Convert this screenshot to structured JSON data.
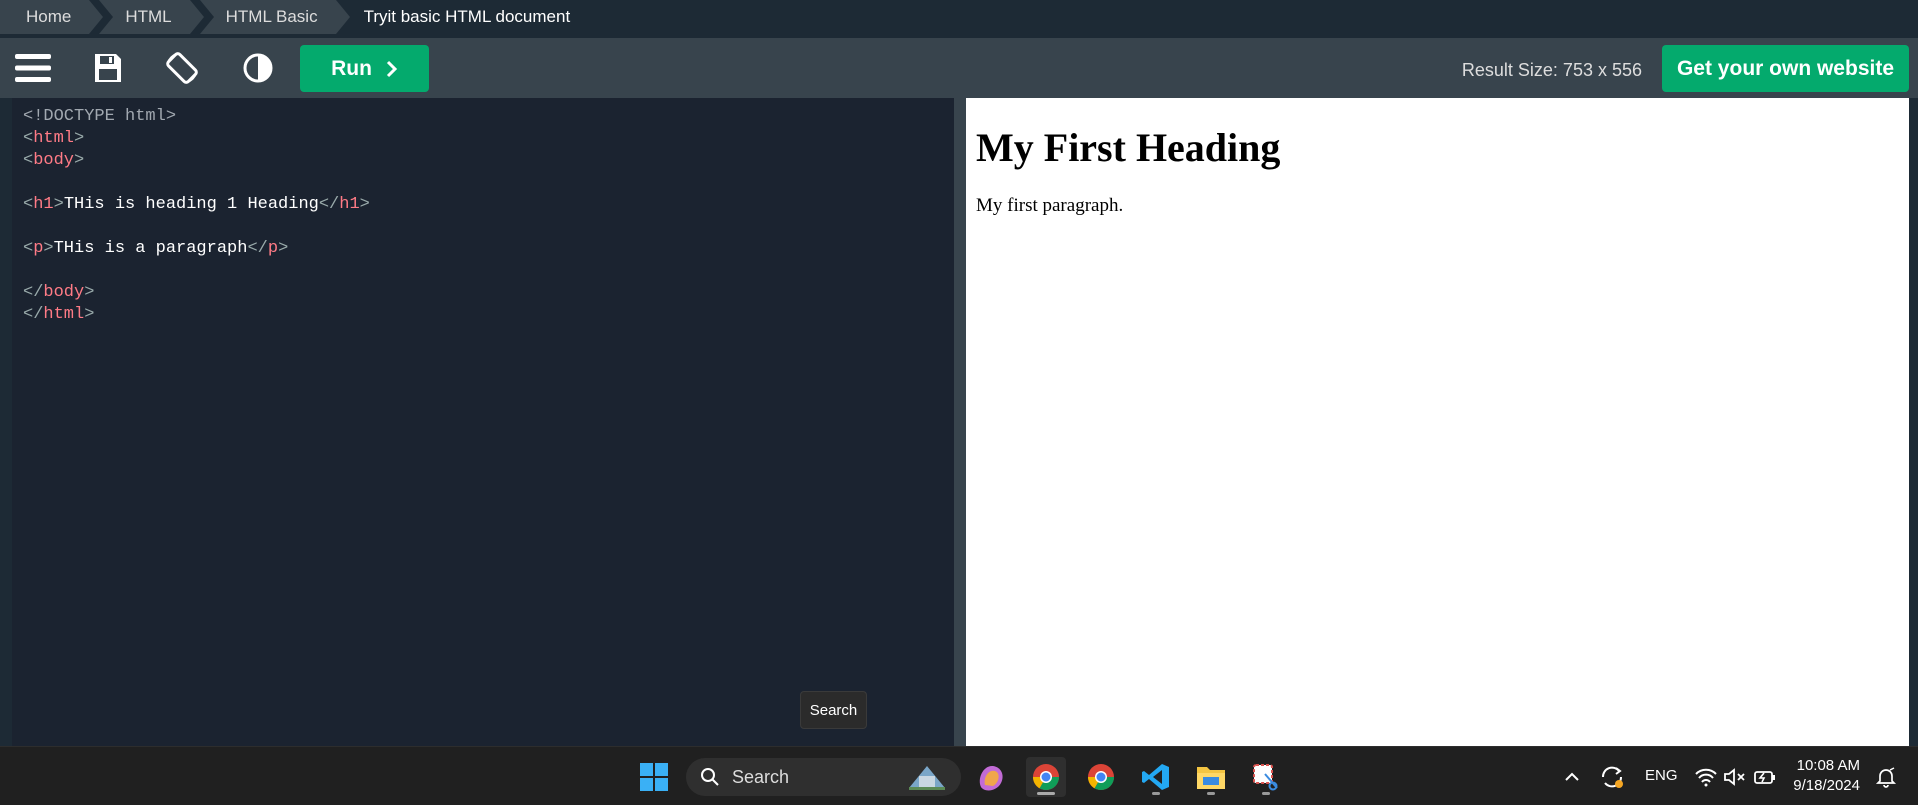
{
  "breadcrumb": {
    "items": [
      "Home",
      "HTML",
      "HTML Basic"
    ],
    "current": "Tryit basic HTML document"
  },
  "toolbar": {
    "menu_icon": "hamburger-icon",
    "save_icon": "save-icon",
    "rotate_icon": "rotate-device-icon",
    "contrast_icon": "contrast-icon",
    "run_label": "Run",
    "result_size": "Result Size: 753 x 556",
    "own_website_label": "Get your own website"
  },
  "editor": {
    "lines": [
      "<!DOCTYPE html>",
      "<html>",
      "<body>",
      "",
      "<h1>THis is heading 1 Heading</h1>",
      "",
      "<p>THis is a paragraph</p>",
      "",
      "</body>",
      "</html>"
    ]
  },
  "result": {
    "heading": "My First Heading",
    "paragraph": "My first paragraph."
  },
  "tooltip": "Search",
  "taskbar": {
    "search_placeholder": "Search",
    "language": "ENG",
    "time": "10:08 AM",
    "date": "9/18/2024"
  },
  "colors": {
    "accent": "#04aa6d",
    "toolbar_bg": "#38444d",
    "editor_bg": "#1b2330",
    "tag_color": "#ff7b86"
  }
}
